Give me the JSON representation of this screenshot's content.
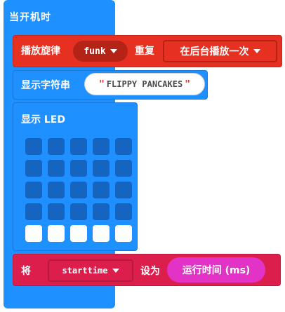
{
  "hat": {
    "label": "当开机时"
  },
  "play_melody": {
    "label": "播放旋律",
    "melody_value": "funk",
    "repeat_label": "重复",
    "mode_value": "在后台播放一次"
  },
  "show_string": {
    "label": "显示字符串",
    "quote_open": "\"",
    "text_value": "FLIPPY PANCAKES",
    "quote_close": "\""
  },
  "show_led": {
    "label": "显示 LED",
    "grid": [
      [
        0,
        0,
        0,
        0,
        0
      ],
      [
        0,
        0,
        0,
        0,
        0
      ],
      [
        0,
        0,
        0,
        0,
        0
      ],
      [
        0,
        0,
        0,
        0,
        0
      ],
      [
        1,
        1,
        1,
        1,
        1
      ]
    ]
  },
  "set_var": {
    "label": "将",
    "variable_value": "starttime",
    "to_label": "设为",
    "value_label": "运行时间 (ms)"
  },
  "colors": {
    "basic": "#1e90ff",
    "music": "#e63022",
    "variables": "#dc1e4c",
    "input": "#e233c6"
  },
  "icons": {
    "dropdown": "chevron-down-icon"
  }
}
